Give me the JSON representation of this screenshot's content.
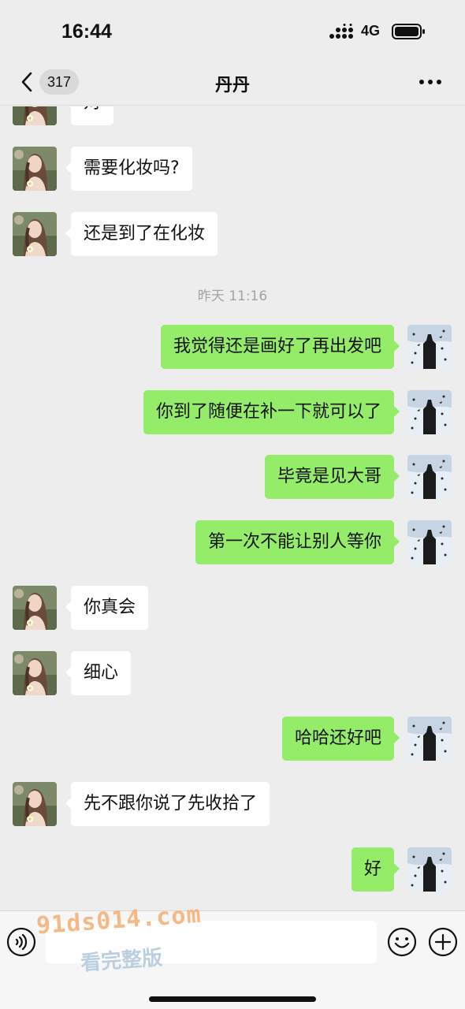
{
  "status_bar": {
    "time": "16:44",
    "network": "4G"
  },
  "nav": {
    "back_count": "317",
    "title": "丹丹"
  },
  "messages": [
    {
      "side": "in",
      "text": "对"
    },
    {
      "side": "in",
      "text": "需要化妆吗?"
    },
    {
      "side": "in",
      "text": "还是到了在化妆"
    },
    {
      "side": "out",
      "text": "我觉得还是画好了再出发吧"
    },
    {
      "side": "out",
      "text": "你到了随便在补一下就可以了"
    },
    {
      "side": "out",
      "text": "毕竟是见大哥"
    },
    {
      "side": "out",
      "text": "第一次不能让别人等你"
    },
    {
      "side": "in",
      "text": "你真会"
    },
    {
      "side": "in",
      "text": "细心"
    },
    {
      "side": "out",
      "text": "哈哈还好吧"
    },
    {
      "side": "in",
      "text": "先不跟你说了先收拾了"
    },
    {
      "side": "out",
      "text": "好"
    }
  ],
  "timestamp": "昨天 11:16",
  "input": {
    "value": "",
    "placeholder": ""
  },
  "watermark": {
    "line1": "91ds014.com",
    "line2": "看完整版"
  },
  "colors": {
    "background": "#ededed",
    "outgoing_bubble": "#95ec69",
    "incoming_bubble": "#ffffff",
    "timestamp": "#a3a3a3"
  },
  "icons": {
    "back": "chevron-left-icon",
    "more": "more-dots-icon",
    "voice": "voice-icon",
    "emoji": "emoji-icon",
    "plus": "plus-icon"
  }
}
